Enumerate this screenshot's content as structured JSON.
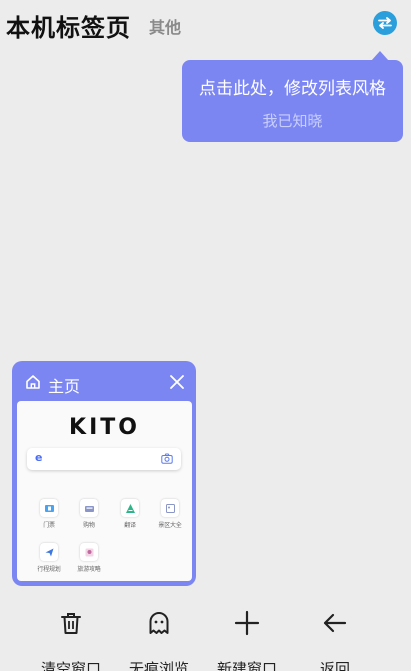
{
  "header": {
    "title": "本机标签页",
    "other_label": "其他",
    "switch_icon": "swap-arrows-icon"
  },
  "tooltip": {
    "message": "点击此处，修改列表风格",
    "ack_label": "我已知晓"
  },
  "tab": {
    "title": "主页",
    "preview": {
      "logo": "KITO",
      "search_mark": "e",
      "shortcuts": [
        {
          "label": "门票",
          "icon": "ticket-icon"
        },
        {
          "label": "购物",
          "icon": "shopping-icon"
        },
        {
          "label": "翻译",
          "icon": "translate-icon"
        },
        {
          "label": "景区大全",
          "icon": "scenic-icon"
        },
        {
          "label": "行程规划",
          "icon": "plan-icon"
        },
        {
          "label": "旅游攻略",
          "icon": "guide-icon"
        }
      ]
    }
  },
  "toolbar": {
    "clear_label": "清空窗口",
    "incognito_label": "无痕浏览",
    "new_label": "新建窗口",
    "back_label": "返回"
  },
  "colors": {
    "accent": "#7b86f3",
    "switch_blue": "#2a9fdc",
    "background": "#ececec"
  }
}
